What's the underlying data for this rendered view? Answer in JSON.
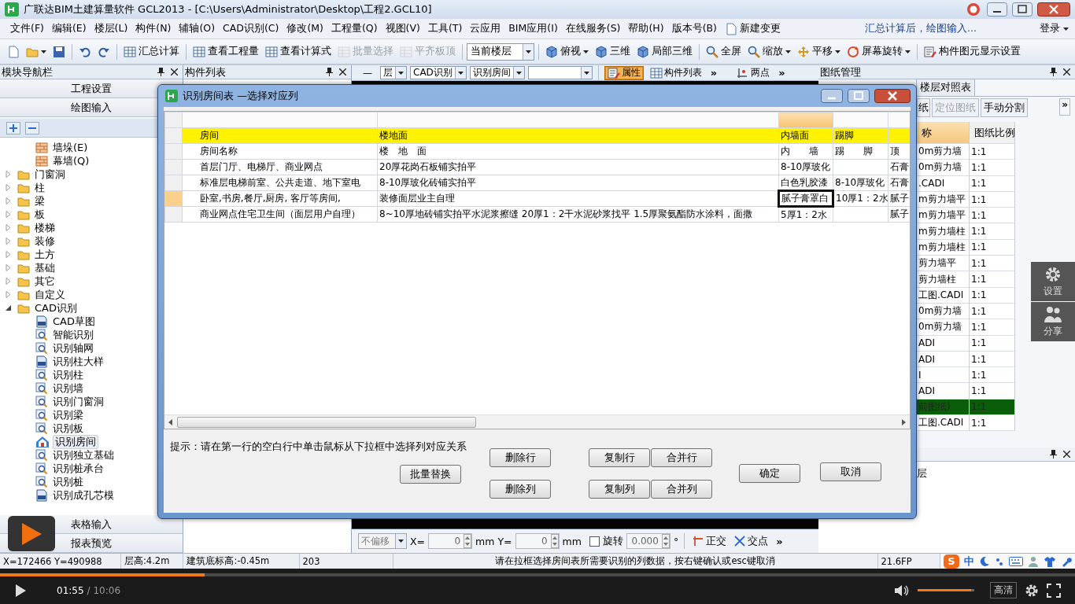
{
  "window": {
    "title": "广联达BIM土建算量软件 GCL2013 - [C:\\Users\\Administrator\\Desktop\\工程2.GCL10]"
  },
  "menu": {
    "items": [
      "文件(F)",
      "编辑(E)",
      "楼层(L)",
      "构件(N)",
      "辅轴(O)",
      "CAD识别(C)",
      "修改(M)",
      "工程量(Q)",
      "视图(V)",
      "工具(T)",
      "云应用",
      "BIM应用(I)",
      "在线服务(S)",
      "帮助(H)",
      "版本号(B)"
    ],
    "action": "新建变更",
    "notice": "汇总计算后，绘图输入...",
    "login": "登录"
  },
  "toolbar": {
    "items": [
      {
        "kind": "button",
        "disabled": false,
        "dropdown": false
      },
      {
        "kind": "button",
        "disabled": false,
        "dropdown": true
      },
      {
        "kind": "button",
        "disabled": false,
        "dropdown": false
      },
      {
        "kind": "button",
        "disabled": false,
        "dropdown": false
      },
      {
        "kind": "button",
        "disabled": false,
        "dropdown": false
      },
      {
        "kind": "button",
        "label": "汇总计算",
        "disabled": false,
        "dropdown": false
      },
      {
        "kind": "button",
        "label": "查看工程量",
        "disabled": false,
        "dropdown": false
      },
      {
        "kind": "button",
        "label": "查看计算式",
        "disabled": false,
        "dropdown": false
      },
      {
        "kind": "button",
        "label": "批量选择",
        "disabled": true,
        "dropdown": false
      },
      {
        "kind": "button",
        "label": "平齐板顶",
        "disabled": true,
        "dropdown": false
      },
      {
        "kind": "combo",
        "value": "当前楼层"
      },
      {
        "kind": "button",
        "label": "俯视",
        "disabled": false,
        "dropdown": true
      },
      {
        "kind": "button",
        "label": "三维",
        "disabled": false,
        "dropdown": false
      },
      {
        "kind": "button",
        "label": "局部三维",
        "disabled": false,
        "dropdown": false
      },
      {
        "kind": "button",
        "label": "全屏",
        "disabled": false,
        "dropdown": false
      },
      {
        "kind": "button",
        "label": "缩放",
        "disabled": false,
        "dropdown": true
      },
      {
        "kind": "button",
        "label": "平移",
        "disabled": false,
        "dropdown": true
      },
      {
        "kind": "button",
        "label": "屏幕旋转",
        "disabled": false,
        "dropdown": true
      },
      {
        "kind": "button",
        "label": "构件图元显示设置",
        "disabled": false,
        "dropdown": false
      }
    ]
  },
  "nav_panel": {
    "title": "模块导航栏",
    "top_sections": [
      "工程设置",
      "绘图输入"
    ],
    "tree": [
      {
        "children": [
          {
            "label": "墙垛(E)",
            "kind": "wall",
            "selected": false
          },
          {
            "label": "幕墙(Q)",
            "kind": "wall",
            "selected": false
          }
        ]
      },
      {
        "label": "门窗洞",
        "kind": "folder",
        "expanded": false,
        "selected": false
      },
      {
        "label": "柱",
        "kind": "folder",
        "expanded": false,
        "selected": false
      },
      {
        "label": "梁",
        "kind": "folder",
        "expanded": false,
        "selected": false
      },
      {
        "label": "板",
        "kind": "folder",
        "expanded": false,
        "selected": false
      },
      {
        "label": "楼梯",
        "kind": "folder",
        "expanded": false,
        "selected": false
      },
      {
        "label": "装修",
        "kind": "folder",
        "expanded": false,
        "selected": false
      },
      {
        "label": "土方",
        "kind": "folder",
        "expanded": false,
        "selected": false
      },
      {
        "label": "基础",
        "kind": "folder",
        "expanded": false,
        "selected": false
      },
      {
        "label": "其它",
        "kind": "folder",
        "expanded": false,
        "selected": false
      },
      {
        "label": "自定义",
        "kind": "folder",
        "expanded": false,
        "selected": false
      },
      {
        "label": "CAD识别",
        "kind": "folder",
        "expanded": true,
        "selected": false,
        "children": [
          {
            "label": "CAD草图",
            "kind": "cad",
            "selected": false
          },
          {
            "label": "智能识别",
            "kind": "tool",
            "selected": false
          },
          {
            "label": "识别轴网",
            "kind": "tool",
            "selected": false
          },
          {
            "label": "识别柱大样",
            "kind": "cad",
            "selected": false
          },
          {
            "label": "识别柱",
            "kind": "tool",
            "selected": false
          },
          {
            "label": "识别墙",
            "kind": "tool",
            "selected": false
          },
          {
            "label": "识别门窗洞",
            "kind": "tool",
            "selected": false
          },
          {
            "label": "识别梁",
            "kind": "tool",
            "selected": false
          },
          {
            "label": "识别板",
            "kind": "tool",
            "selected": false
          },
          {
            "label": "识别房间",
            "kind": "room",
            "selected": true
          },
          {
            "label": "识别独立基础",
            "kind": "tool",
            "selected": false
          },
          {
            "label": "识别桩承台",
            "kind": "tool",
            "selected": false
          },
          {
            "label": "识别桩",
            "kind": "tool",
            "selected": false
          },
          {
            "label": "识别成孔芯模",
            "kind": "cad",
            "selected": false
          }
        ]
      }
    ],
    "bottom_sections": [
      "表格输入",
      "报表预览"
    ]
  },
  "component_panel": {
    "title": "构件列表"
  },
  "canvas_toolbar": {
    "lead": "—",
    "combos": [
      {
        "kind": "text",
        "value": "层"
      },
      {
        "kind": "text",
        "value": "CAD识别"
      },
      {
        "kind": "text",
        "value": "识别房间"
      },
      {
        "kind": "blank"
      }
    ],
    "toggles": [
      {
        "label": "属性",
        "selected": true
      },
      {
        "label": "构件列表",
        "selected": false
      }
    ],
    "more": "»",
    "snap": "两点",
    "snap_more": "»"
  },
  "bottom_toolbar": {
    "offset": {
      "value": "不偏移",
      "disabled": true
    },
    "x_label": "X=",
    "x_value": "0",
    "x_unit": "mm",
    "y_label": "Y=",
    "y_value": "0",
    "y_unit": "mm",
    "rotate": {
      "label": "旋转",
      "checked": false
    },
    "angle": "0.000",
    "angle_unit": "°",
    "snaps": [
      {
        "label": "正交"
      },
      {
        "label": "交点"
      }
    ],
    "more": "»"
  },
  "drawing_panel": {
    "title": "图纸管理",
    "tabs": [
      {
        "label": "楼层对照表",
        "selected": false
      }
    ],
    "buttons": [
      {
        "label": "纸",
        "disabled": false
      },
      {
        "label": "定位图纸",
        "disabled": true
      },
      {
        "label": "手动分割",
        "disabled": false
      }
    ],
    "more": "»",
    "columns": [
      "称",
      "图纸比例"
    ],
    "rows": [
      {
        "name": "0m剪力墙",
        "scale": "1:1",
        "selected": false
      },
      {
        "name": "0m剪力墙",
        "scale": "1:1",
        "selected": false
      },
      {
        "name": ".CADI",
        "scale": "1:1",
        "selected": false
      },
      {
        "name": "m剪力墙平",
        "scale": "1:1",
        "selected": false
      },
      {
        "name": "m剪力墙平",
        "scale": "1:1",
        "selected": false
      },
      {
        "name": "m剪力墙柱",
        "scale": "1:1",
        "selected": false
      },
      {
        "name": "m剪力墙柱",
        "scale": "1:1",
        "selected": false
      },
      {
        "name": "剪力墙平",
        "scale": "1:1",
        "selected": false
      },
      {
        "name": "剪力墙柱",
        "scale": "1:1",
        "selected": false
      },
      {
        "name": "工图.CADI",
        "scale": "1:1",
        "selected": false
      },
      {
        "name": "0m剪力墙",
        "scale": "1:1",
        "selected": false
      },
      {
        "name": "0m剪力墙",
        "scale": "1:1",
        "selected": false
      },
      {
        "name": "ADI",
        "scale": "1:1",
        "selected": false
      },
      {
        "name": "ADI",
        "scale": "1:1",
        "selected": false
      },
      {
        "name": "I",
        "scale": "1:1",
        "selected": false
      },
      {
        "name": "ADI",
        "scale": "1:1",
        "selected": false
      },
      {
        "name": "前图纸)",
        "scale": "1:1",
        "selected": true
      },
      {
        "name": "工图.CADI",
        "scale": "1:1",
        "selected": false
      }
    ]
  },
  "layer_panel": {
    "content": "层"
  },
  "dialog": {
    "title": "识别房间表 —选择对应列",
    "columns": [
      {
        "label": "房间",
        "selected": false
      },
      {
        "label": "楼地面",
        "selected": false
      },
      {
        "label": "内墙面",
        "selected": true
      },
      {
        "label": "踢脚",
        "selected": false
      },
      {
        "selected": false
      }
    ],
    "rows": [
      {
        "cells": [
          "房间名称",
          "楼　地　面",
          "内　　墙",
          "踢　　脚",
          "顶"
        ],
        "selected": false
      },
      {
        "cells": [
          "首层门厅、电梯厅、商业网点",
          "20厚花岗石板铺实拍平",
          "8-10厚玻化",
          null,
          "石膏"
        ],
        "selected": false
      },
      {
        "cells": [
          "标准层电梯前室、公共走道、地下室电",
          "8-10厚玻化砖铺实拍平",
          "白色乳胶漆",
          "8-10厚玻化",
          "石膏"
        ],
        "selected": false
      },
      {
        "cells": [
          "卧室,书房,餐厅,厨房, 客厅等房间,",
          "装修面层业主自理",
          "腻子膏罩白",
          "10厚1：2水",
          "腻子"
        ],
        "selected": true
      },
      {
        "cells": [
          "商业网点住宅卫生间（面层用户自理）",
          "8~10厚地砖铺实拍平水泥浆擦缝 20厚1：2干水泥砂浆找平 1.5厚聚氨酯防水涂料，面撒",
          "5厚1：2水",
          null,
          "腻子"
        ],
        "selected": false
      }
    ],
    "hint": "提示：请在第一行的空白行中单击鼠标从下拉框中选择列对应关系",
    "replace": "批量替换",
    "edit_buttons": [
      {
        "top": "删除行",
        "bottom": "删除列"
      },
      {
        "top": "复制行",
        "bottom": "复制列"
      },
      {
        "top": "合并行",
        "bottom": "合并列"
      }
    ],
    "ok": "确定",
    "cancel": "取消"
  },
  "status_bar": {
    "coords": "X=172466 Y=490988",
    "floor_height": "层高:4.2m",
    "base_elevation": "建筑底标高:-0.45m",
    "count": "203",
    "message": "请在拉框选择房间表所需要识别的列数据，按右键确认或esc键取消",
    "fps": "21.6FP",
    "ime_logo": "S",
    "ime_mode": "中"
  },
  "side_buttons": [
    {
      "label": "设置",
      "kind": "settings"
    },
    {
      "label": "分享",
      "kind": "share"
    }
  ],
  "player": {
    "progress": {
      "level": 0.19
    },
    "time": "01:55",
    "duration": "/ 10:06",
    "volume": {
      "level": 0.95
    },
    "quality": "高清"
  }
}
